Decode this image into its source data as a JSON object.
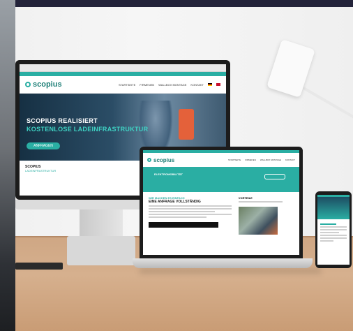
{
  "monitor": {
    "brand": "scopius",
    "nav": [
      "STARTSEITE",
      "FIRMENEN",
      "WALLBOX MONTAGE",
      "KONTAKT"
    ],
    "hero_title": "SCOPIUS REALISIERT",
    "hero_subtitle": "KOSTENLOSE LADEINFRASTRUKTUR",
    "hero_button": "ANFRAGEN",
    "section_title": "SCOPIUS",
    "section_subtitle": "LADEINFRASTRUKTUR"
  },
  "laptop": {
    "brand": "scopius",
    "band_title": "ELEKTROMOBILITÄT",
    "col1_head": "WIR MACHEN ES EINFACH",
    "col1_head2": "EINE ANFRAGE VOLLSTÄNDIG",
    "col2_head": "VORTEILE"
  },
  "colors": {
    "teal": "#2aaea3",
    "dark_frame": "#1c1c1c",
    "desk": "#d6b08e"
  }
}
